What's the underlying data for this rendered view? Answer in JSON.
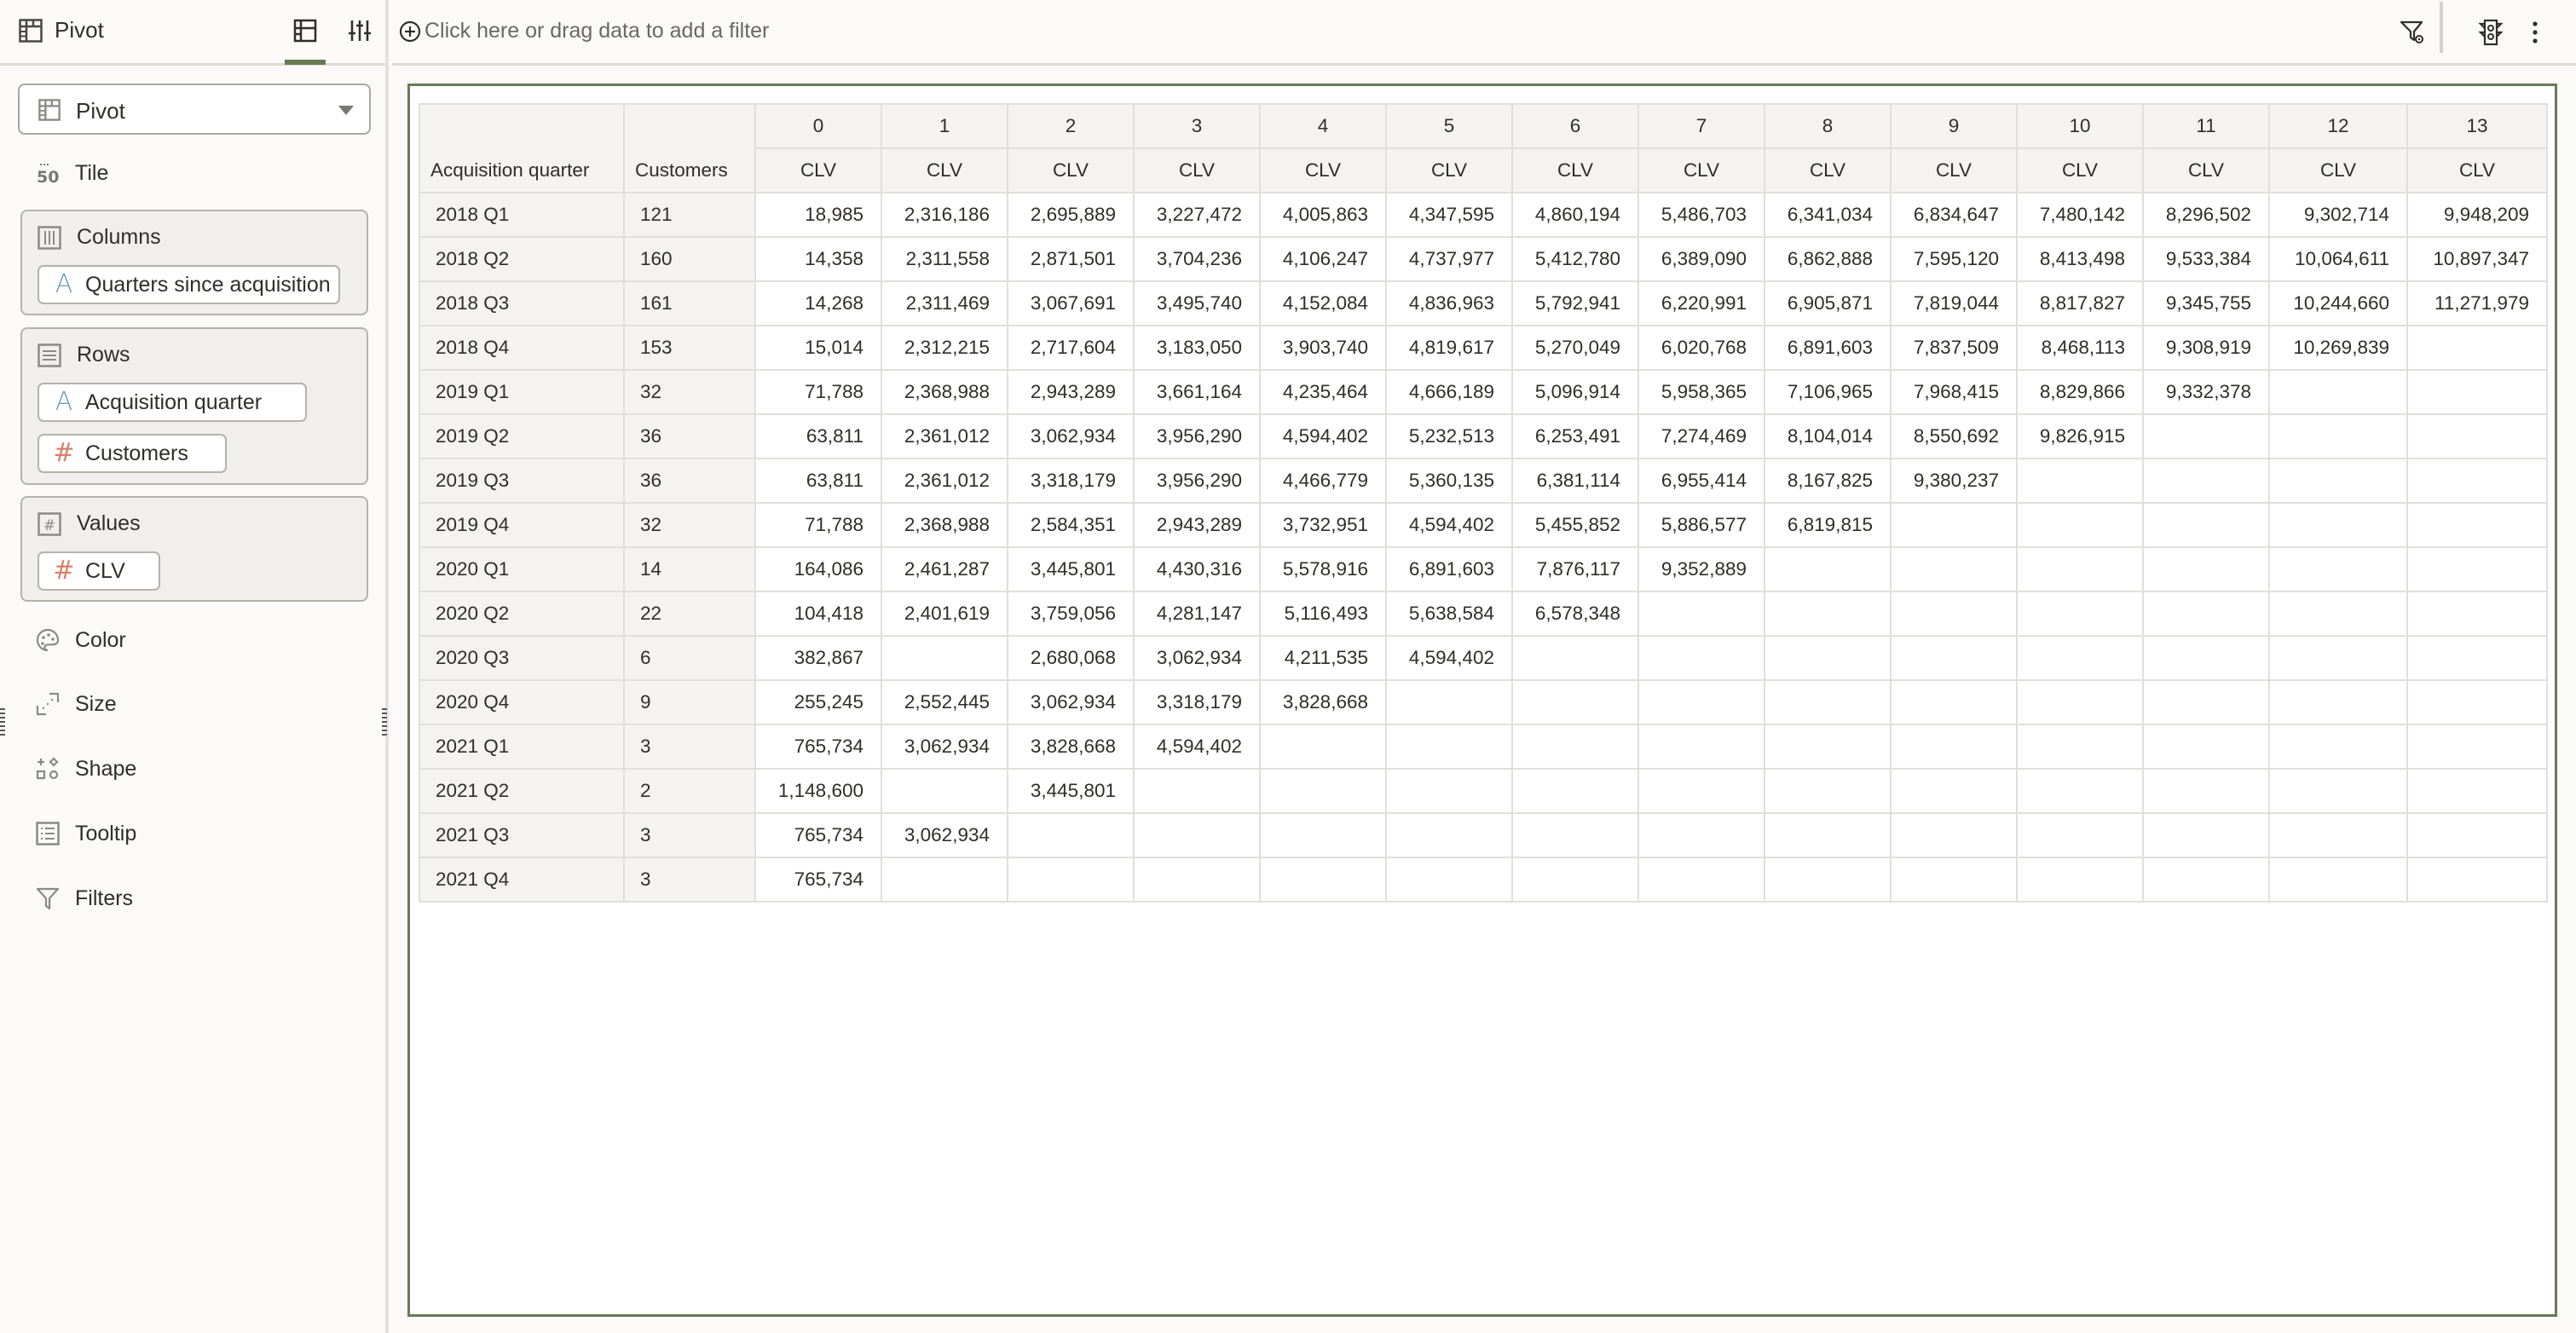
{
  "left_panel": {
    "title": "Pivot",
    "tabs": [
      {
        "name": "grammar",
        "icon": "grammar-icon",
        "active": true
      },
      {
        "name": "properties",
        "icon": "sliders-icon",
        "active": false
      }
    ],
    "viz_type": {
      "label": "Pivot",
      "icon": "pivot-icon"
    },
    "tile_label": "Tile",
    "sections": {
      "columns": {
        "label": "Columns",
        "items": [
          {
            "label": "Quarters since acquisition",
            "type": "attribute"
          }
        ]
      },
      "rows": {
        "label": "Rows",
        "items": [
          {
            "label": "Acquisition quarter",
            "type": "attribute"
          },
          {
            "label": "Customers",
            "type": "measure"
          }
        ]
      },
      "values": {
        "label": "Values",
        "items": [
          {
            "label": "CLV",
            "type": "measure"
          }
        ]
      }
    },
    "grammar_items": {
      "color": "Color",
      "size": "Size",
      "shape": "Shape",
      "tooltip": "Tooltip",
      "filters": "Filters"
    }
  },
  "filter_bar": {
    "add_filter_text": "Click here or drag data to add a filter"
  },
  "pivot": {
    "row_headers": [
      "Acquisition quarter",
      "Customers"
    ],
    "column_dimension_values": [
      "0",
      "1",
      "2",
      "3",
      "4",
      "5",
      "6",
      "7",
      "8",
      "9",
      "10",
      "11",
      "12",
      "13"
    ],
    "measure_label": "CLV",
    "rows": [
      {
        "quarter": "2018 Q1",
        "customers": "121",
        "values": [
          "18,985",
          "2,316,186",
          "2,695,889",
          "3,227,472",
          "4,005,863",
          "4,347,595",
          "4,860,194",
          "5,486,703",
          "6,341,034",
          "6,834,647",
          "7,480,142",
          "8,296,502",
          "9,302,714",
          "9,948,209"
        ]
      },
      {
        "quarter": "2018 Q2",
        "customers": "160",
        "values": [
          "14,358",
          "2,311,558",
          "2,871,501",
          "3,704,236",
          "4,106,247",
          "4,737,977",
          "5,412,780",
          "6,389,090",
          "6,862,888",
          "7,595,120",
          "8,413,498",
          "9,533,384",
          "10,064,611",
          "10,897,347"
        ]
      },
      {
        "quarter": "2018 Q3",
        "customers": "161",
        "values": [
          "14,268",
          "2,311,469",
          "3,067,691",
          "3,495,740",
          "4,152,084",
          "4,836,963",
          "5,792,941",
          "6,220,991",
          "6,905,871",
          "7,819,044",
          "8,817,827",
          "9,345,755",
          "10,244,660",
          "11,271,979"
        ]
      },
      {
        "quarter": "2018 Q4",
        "customers": "153",
        "values": [
          "15,014",
          "2,312,215",
          "2,717,604",
          "3,183,050",
          "3,903,740",
          "4,819,617",
          "5,270,049",
          "6,020,768",
          "6,891,603",
          "7,837,509",
          "8,468,113",
          "9,308,919",
          "10,269,839",
          ""
        ]
      },
      {
        "quarter": "2019 Q1",
        "customers": "32",
        "values": [
          "71,788",
          "2,368,988",
          "2,943,289",
          "3,661,164",
          "4,235,464",
          "4,666,189",
          "5,096,914",
          "5,958,365",
          "7,106,965",
          "7,968,415",
          "8,829,866",
          "9,332,378",
          "",
          ""
        ]
      },
      {
        "quarter": "2019 Q2",
        "customers": "36",
        "values": [
          "63,811",
          "2,361,012",
          "3,062,934",
          "3,956,290",
          "4,594,402",
          "5,232,513",
          "6,253,491",
          "7,274,469",
          "8,104,014",
          "8,550,692",
          "9,826,915",
          "",
          "",
          ""
        ]
      },
      {
        "quarter": "2019 Q3",
        "customers": "36",
        "values": [
          "63,811",
          "2,361,012",
          "3,318,179",
          "3,956,290",
          "4,466,779",
          "5,360,135",
          "6,381,114",
          "6,955,414",
          "8,167,825",
          "9,380,237",
          "",
          "",
          "",
          ""
        ]
      },
      {
        "quarter": "2019 Q4",
        "customers": "32",
        "values": [
          "71,788",
          "2,368,988",
          "2,584,351",
          "2,943,289",
          "3,732,951",
          "4,594,402",
          "5,455,852",
          "5,886,577",
          "6,819,815",
          "",
          "",
          "",
          "",
          ""
        ]
      },
      {
        "quarter": "2020 Q1",
        "customers": "14",
        "values": [
          "164,086",
          "2,461,287",
          "3,445,801",
          "4,430,316",
          "5,578,916",
          "6,891,603",
          "7,876,117",
          "9,352,889",
          "",
          "",
          "",
          "",
          "",
          ""
        ]
      },
      {
        "quarter": "2020 Q2",
        "customers": "22",
        "values": [
          "104,418",
          "2,401,619",
          "3,759,056",
          "4,281,147",
          "5,116,493",
          "5,638,584",
          "6,578,348",
          "",
          "",
          "",
          "",
          "",
          "",
          ""
        ]
      },
      {
        "quarter": "2020 Q3",
        "customers": "6",
        "values": [
          "382,867",
          "",
          "2,680,068",
          "3,062,934",
          "4,211,535",
          "4,594,402",
          "",
          "",
          "",
          "",
          "",
          "",
          "",
          ""
        ]
      },
      {
        "quarter": "2020 Q4",
        "customers": "9",
        "values": [
          "255,245",
          "2,552,445",
          "3,062,934",
          "3,318,179",
          "3,828,668",
          "",
          "",
          "",
          "",
          "",
          "",
          "",
          "",
          ""
        ]
      },
      {
        "quarter": "2021 Q1",
        "customers": "3",
        "values": [
          "765,734",
          "3,062,934",
          "3,828,668",
          "4,594,402",
          "",
          "",
          "",
          "",
          "",
          "",
          "",
          "",
          "",
          ""
        ]
      },
      {
        "quarter": "2021 Q2",
        "customers": "2",
        "values": [
          "1,148,600",
          "",
          "3,445,801",
          "",
          "",
          "",
          "",
          "",
          "",
          "",
          "",
          "",
          "",
          ""
        ]
      },
      {
        "quarter": "2021 Q3",
        "customers": "3",
        "values": [
          "765,734",
          "3,062,934",
          "",
          "",
          "",
          "",
          "",
          "",
          "",
          "",
          "",
          "",
          "",
          ""
        ]
      },
      {
        "quarter": "2021 Q4",
        "customers": "3",
        "values": [
          "765,734",
          "",
          "",
          "",
          "",
          "",
          "",
          "",
          "",
          "",
          "",
          "",
          "",
          ""
        ]
      }
    ]
  },
  "colors": {
    "accent": "#667b55",
    "attribute_icon": "#6d9cb5",
    "measure_icon": "#d7806b",
    "header_bg": "#f4f3f1",
    "panel_bg": "#fbfaf8"
  }
}
